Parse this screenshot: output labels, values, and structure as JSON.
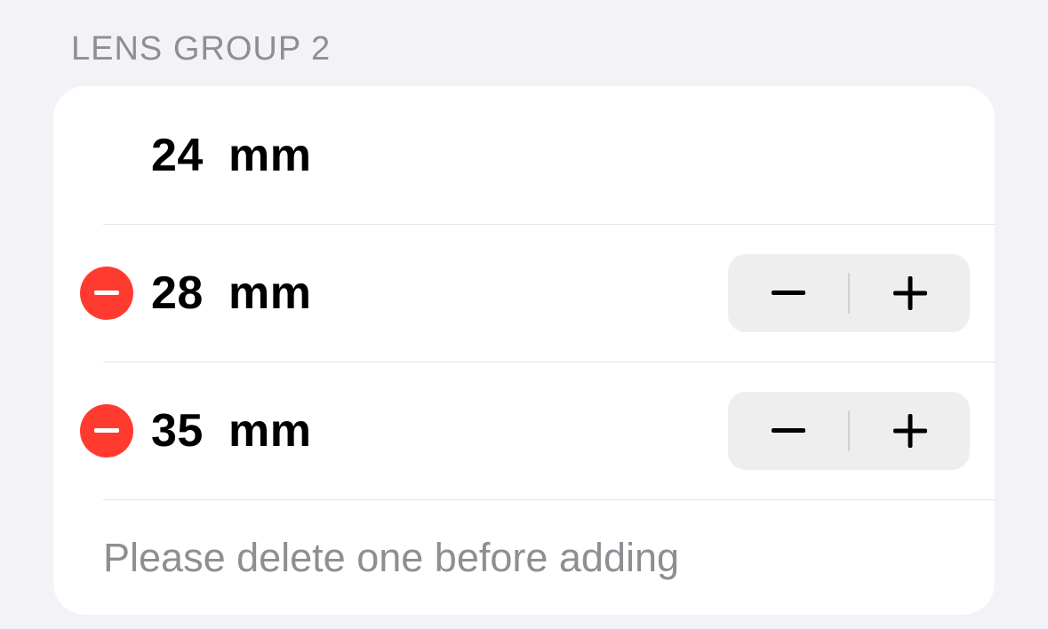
{
  "section": {
    "title": "LENS GROUP 2",
    "footer": "Please delete one before adding"
  },
  "unit": "mm",
  "items": [
    {
      "value": "24",
      "deletable": false,
      "stepper": false
    },
    {
      "value": "28",
      "deletable": true,
      "stepper": true
    },
    {
      "value": "35",
      "deletable": true,
      "stepper": true
    }
  ]
}
